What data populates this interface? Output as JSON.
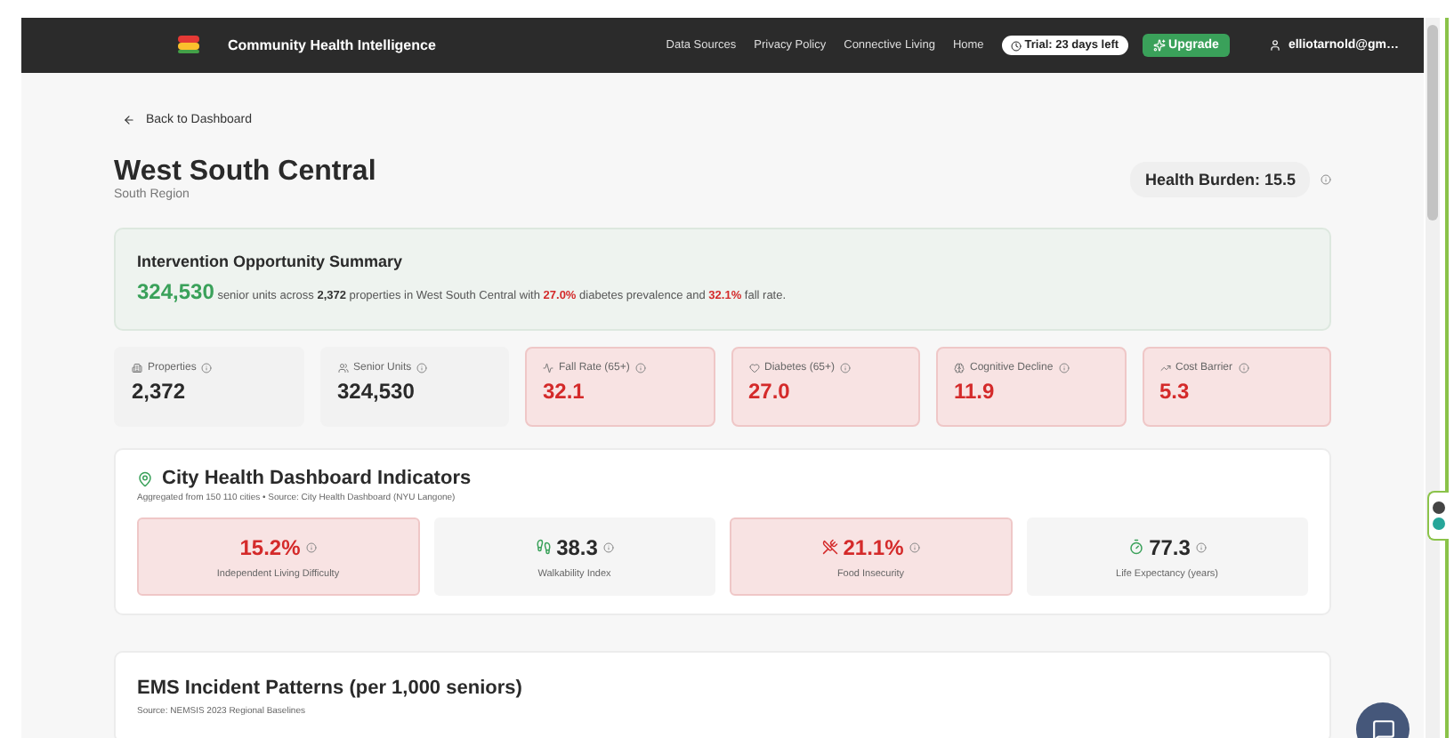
{
  "header": {
    "brand": "Community Health Intelligence",
    "nav": [
      "Data Sources",
      "Privacy Policy",
      "Connective Living",
      "Home"
    ],
    "trial": "Trial: 23 days left",
    "upgrade": "Upgrade",
    "user": "elliotarnold@gm…"
  },
  "back": "Back to Dashboard",
  "region": {
    "title": "West South Central",
    "subtitle": "South Region",
    "burden": "Health Burden: 15.5"
  },
  "summary": {
    "title": "Intervention Opportunity Summary",
    "segments": [
      {
        "text": "324,530",
        "kind": "big"
      },
      {
        "text": " senior units across ",
        "kind": "plain"
      },
      {
        "text": "2,372",
        "kind": "bold"
      },
      {
        "text": " properties in West South Central with ",
        "kind": "plain"
      },
      {
        "text": "27.0%",
        "kind": "alert"
      },
      {
        "text": " diabetes prevalence and ",
        "kind": "plain"
      },
      {
        "text": "32.1%",
        "kind": "alert"
      },
      {
        "text": " fall rate.",
        "kind": "plain"
      }
    ]
  },
  "stats": [
    {
      "label": "Properties",
      "value": "2,372",
      "highlighted": false
    },
    {
      "label": "Senior Units",
      "value": "324,530",
      "highlighted": false
    },
    {
      "label": "Fall Rate (65+)",
      "value": "32.1",
      "highlighted": true
    },
    {
      "label": "Diabetes (65+)",
      "value": "27.0",
      "highlighted": true
    },
    {
      "label": "Cognitive Decline",
      "value": "11.9",
      "highlighted": true
    },
    {
      "label": "Cost Barrier",
      "value": "5.3",
      "highlighted": true
    }
  ],
  "city": {
    "title": "City Health Dashboard Indicators",
    "subtitle": "Aggregated from 150 110 cities • Source: City Health Dashboard (NYU Langone)",
    "indicators": [
      {
        "value": "15.2%",
        "label": "Independent Living Difficulty",
        "highlighted": true
      },
      {
        "value": "38.3",
        "label": "Walkability Index",
        "highlighted": false
      },
      {
        "value": "21.1%",
        "label": "Food Insecurity",
        "highlighted": true
      },
      {
        "value": "77.3",
        "label": "Life Expectancy (years)",
        "highlighted": false
      }
    ]
  },
  "ems": {
    "title": "EMS Incident Patterns (per 1,000 seniors)",
    "subtitle": "Source: NEMSIS 2023 Regional Baselines"
  }
}
